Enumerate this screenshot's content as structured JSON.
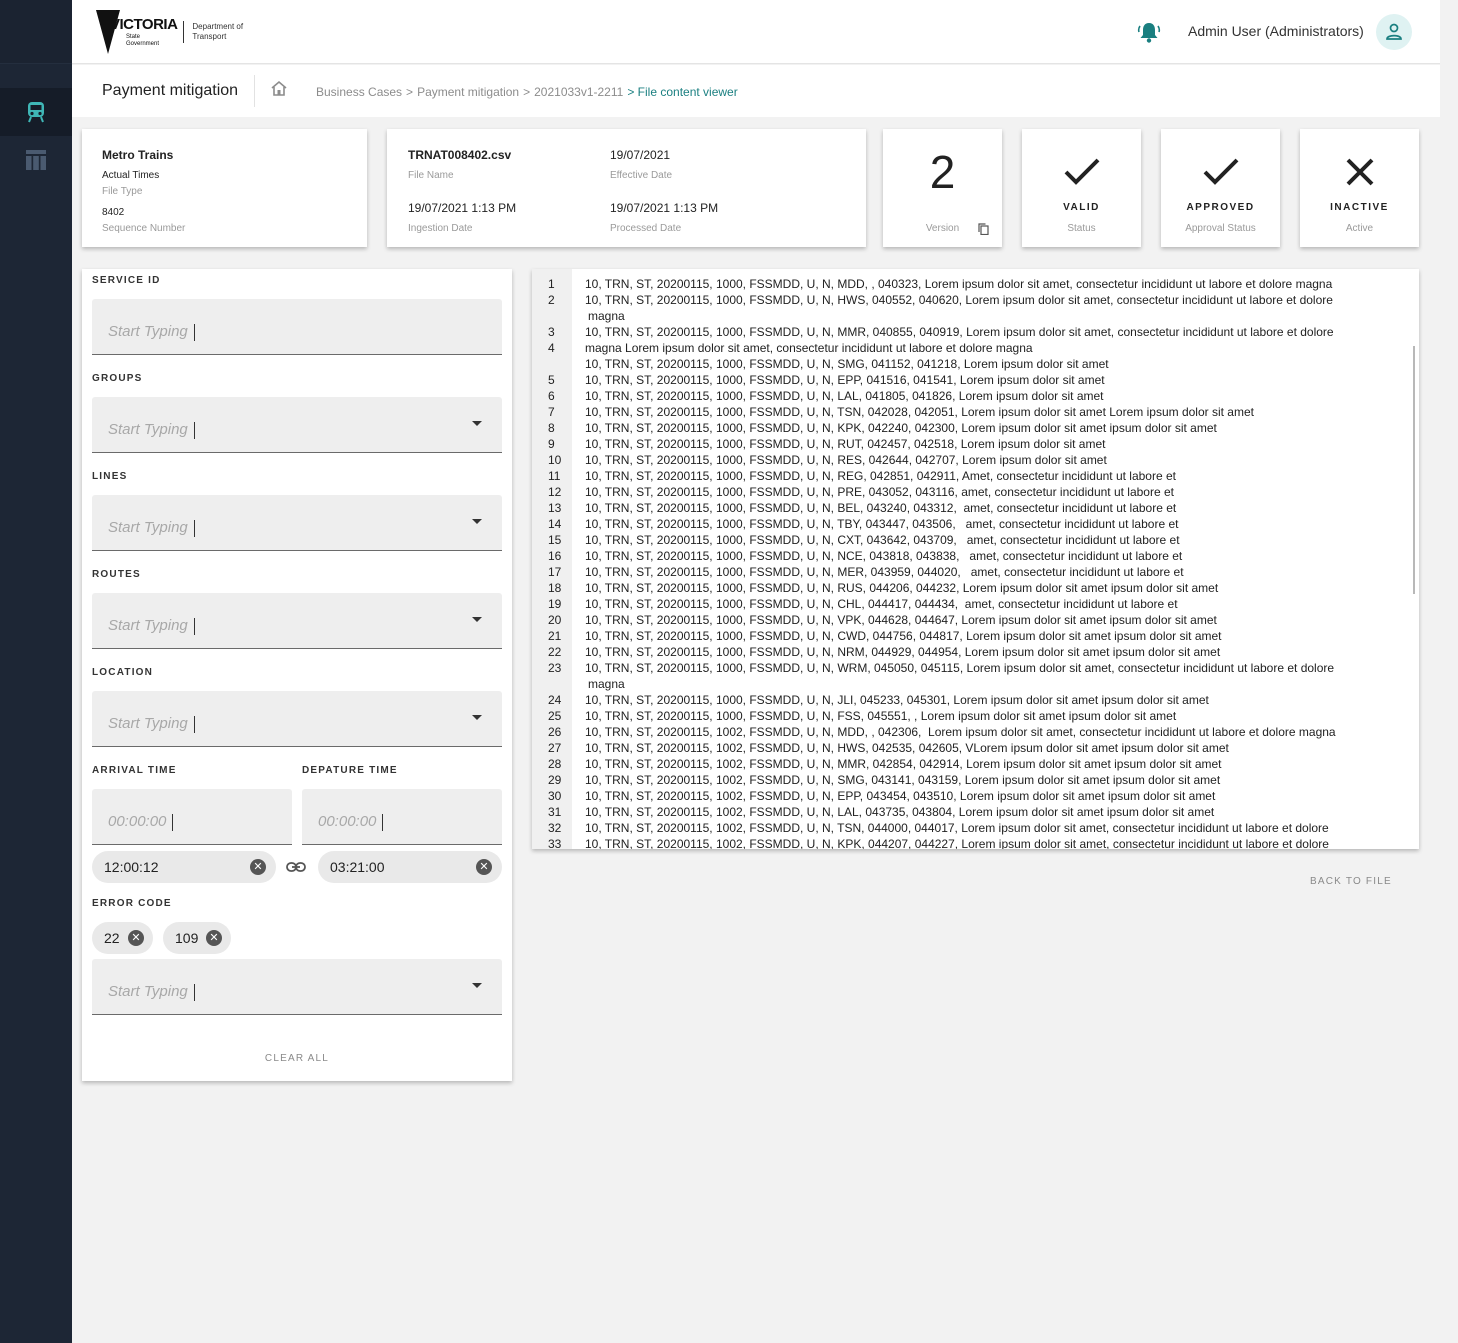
{
  "header": {
    "logo_main": "VICTORIA",
    "logo_sub": "State Government",
    "logo_dept": "Department of Transport",
    "user_name": "Admin User (Administrators)"
  },
  "sidebar": {
    "items": [
      {
        "icon": "train-icon",
        "active": true
      },
      {
        "icon": "table-icon",
        "active": false
      }
    ]
  },
  "breadcrumb": {
    "page_title": "Payment mitigation",
    "items": [
      "Business Cases",
      ">",
      "Payment mitigation",
      ">",
      "2021033v1-2211"
    ],
    "current": "> File content viewer"
  },
  "cards": {
    "operator": {
      "name": "Metro Trains",
      "file_type": "Actual Times",
      "file_type_label": "File Type",
      "sequence": "8402",
      "sequence_label": "Sequence Number"
    },
    "file": {
      "file_name": "TRNAT008402.csv",
      "file_name_label": "File Name",
      "effective_date": "19/07/2021",
      "effective_date_label": "Effective Date",
      "ingestion_date": "19/07/2021 1:13 PM",
      "ingestion_date_label": "Ingestion Date",
      "processed_date": "19/07/2021 1:13 PM",
      "processed_date_label": "Processed Date"
    },
    "version": {
      "value": "2",
      "label": "Version"
    },
    "status": {
      "value": "VALID",
      "label": "Status"
    },
    "approval": {
      "value": "APPROVED",
      "label": "Approval Status"
    },
    "active": {
      "value": "INACTIVE",
      "label": "Active"
    }
  },
  "filters": {
    "service_id": {
      "label": "SERVICE ID",
      "placeholder": "Start Typing"
    },
    "groups": {
      "label": "GROUPS",
      "placeholder": "Start Typing"
    },
    "lines": {
      "label": "LINES",
      "placeholder": "Start Typing"
    },
    "routes": {
      "label": "ROUTES",
      "placeholder": "Start Typing"
    },
    "location": {
      "label": "LOCATION",
      "placeholder": "Start Typing"
    },
    "arrival": {
      "label": "ARRIVAL TIME",
      "placeholder": "00:00:00",
      "chip": "12:00:12"
    },
    "departure": {
      "label": "DEPATURE TIME",
      "placeholder": "00:00:00",
      "chip": "03:21:00"
    },
    "error_code": {
      "label": "ERROR CODE",
      "chips": [
        "22",
        "109"
      ],
      "placeholder": "Start Typing"
    },
    "clear_all": "CLEAR ALL"
  },
  "viewer": {
    "lines": [
      {
        "n": "1",
        "t": "10, TRN, ST, 20200115, 1000, FSSMDD, U, N, MDD, , 040323, Lorem ipsum dolor sit amet, consectetur incididunt ut labore et dolore magna"
      },
      {
        "n": "2",
        "t": "10, TRN, ST, 20200115, 1000, FSSMDD, U, N, HWS, 040552, 040620, Lorem ipsum dolor sit amet, consectetur incididunt ut labore et dolore magna"
      },
      {
        "n": "3",
        "t": "10, TRN, ST, 20200115, 1000, FSSMDD, U, N, MMR, 040855, 040919, Lorem ipsum dolor sit amet, consectetur incididunt ut labore et dolore"
      },
      {
        "n": "4",
        "t": "magna Lorem ipsum dolor sit amet, consectetur incididunt ut labore et dolore magna"
      },
      {
        "n": "",
        "t": "10, TRN, ST, 20200115, 1000, FSSMDD, U, N, SMG, 041152, 041218, Lorem ipsum dolor sit amet"
      },
      {
        "n": "5",
        "t": "10, TRN, ST, 20200115, 1000, FSSMDD, U, N, EPP, 041516, 041541, Lorem ipsum dolor sit amet"
      },
      {
        "n": "6",
        "t": "10, TRN, ST, 20200115, 1000, FSSMDD, U, N, LAL, 041805, 041826, Lorem ipsum dolor sit amet"
      },
      {
        "n": "7",
        "t": "10, TRN, ST, 20200115, 1000, FSSMDD, U, N, TSN, 042028, 042051, Lorem ipsum dolor sit amet Lorem ipsum dolor sit amet"
      },
      {
        "n": "8",
        "t": "10, TRN, ST, 20200115, 1000, FSSMDD, U, N, KPK, 042240, 042300, Lorem ipsum dolor sit amet ipsum dolor sit amet"
      },
      {
        "n": "9",
        "t": "10, TRN, ST, 20200115, 1000, FSSMDD, U, N, RUT, 042457, 042518, Lorem ipsum dolor sit amet"
      },
      {
        "n": "10",
        "t": "10, TRN, ST, 20200115, 1000, FSSMDD, U, N, RES, 042644, 042707, Lorem ipsum dolor sit amet"
      },
      {
        "n": "11",
        "t": "10, TRN, ST, 20200115, 1000, FSSMDD, U, N, REG, 042851, 042911, Amet, consectetur incididunt ut labore et"
      },
      {
        "n": "12",
        "t": "10, TRN, ST, 20200115, 1000, FSSMDD, U, N, PRE, 043052, 043116, amet, consectetur incididunt ut labore et"
      },
      {
        "n": "13",
        "t": "10, TRN, ST, 20200115, 1000, FSSMDD, U, N, BEL, 043240, 043312,  amet, consectetur incididunt ut labore et"
      },
      {
        "n": "14",
        "t": "10, TRN, ST, 20200115, 1000, FSSMDD, U, N, TBY, 043447, 043506,   amet, consectetur incididunt ut labore et"
      },
      {
        "n": "15",
        "t": "10, TRN, ST, 20200115, 1000, FSSMDD, U, N, CXT, 043642, 043709,   amet, consectetur incididunt ut labore et"
      },
      {
        "n": "16",
        "t": "10, TRN, ST, 20200115, 1000, FSSMDD, U, N, NCE, 043818, 043838,   amet, consectetur incididunt ut labore et"
      },
      {
        "n": "17",
        "t": "10, TRN, ST, 20200115, 1000, FSSMDD, U, N, MER, 043959, 044020,   amet, consectetur incididunt ut labore et"
      },
      {
        "n": "18",
        "t": "10, TRN, ST, 20200115, 1000, FSSMDD, U, N, RUS, 044206, 044232, Lorem ipsum dolor sit amet ipsum dolor sit amet"
      },
      {
        "n": "19",
        "t": "10, TRN, ST, 20200115, 1000, FSSMDD, U, N, CHL, 044417, 044434,  amet, consectetur incididunt ut labore et"
      },
      {
        "n": "20",
        "t": "10, TRN, ST, 20200115, 1000, FSSMDD, U, N, VPK, 044628, 044647, Lorem ipsum dolor sit amet ipsum dolor sit amet"
      },
      {
        "n": "21",
        "t": "10, TRN, ST, 20200115, 1000, FSSMDD, U, N, CWD, 044756, 044817, Lorem ipsum dolor sit amet ipsum dolor sit amet"
      },
      {
        "n": "22",
        "t": "10, TRN, ST, 20200115, 1000, FSSMDD, U, N, NRM, 044929, 044954, Lorem ipsum dolor sit amet ipsum dolor sit amet"
      },
      {
        "n": "23",
        "t": "10, TRN, ST, 20200115, 1000, FSSMDD, U, N, WRM, 045050, 045115, Lorem ipsum dolor sit amet, consectetur incididunt ut labore et dolore magna"
      },
      {
        "n": "24",
        "t": "10, TRN, ST, 20200115, 1000, FSSMDD, U, N, JLI, 045233, 045301, Lorem ipsum dolor sit amet ipsum dolor sit amet"
      },
      {
        "n": "25",
        "t": "10, TRN, ST, 20200115, 1000, FSSMDD, U, N, FSS, 045551, , Lorem ipsum dolor sit amet ipsum dolor sit amet"
      },
      {
        "n": "26",
        "t": "10, TRN, ST, 20200115, 1002, FSSMDD, U, N, MDD, , 042306,  Lorem ipsum dolor sit amet, consectetur incididunt ut labore et dolore magna"
      },
      {
        "n": "27",
        "t": "10, TRN, ST, 20200115, 1002, FSSMDD, U, N, HWS, 042535, 042605, VLorem ipsum dolor sit amet ipsum dolor sit amet"
      },
      {
        "n": "28",
        "t": "10, TRN, ST, 20200115, 1002, FSSMDD, U, N, MMR, 042854, 042914, Lorem ipsum dolor sit amet ipsum dolor sit amet"
      },
      {
        "n": "29",
        "t": "10, TRN, ST, 20200115, 1002, FSSMDD, U, N, SMG, 043141, 043159, Lorem ipsum dolor sit amet ipsum dolor sit amet"
      },
      {
        "n": "30",
        "t": "10, TRN, ST, 20200115, 1002, FSSMDD, U, N, EPP, 043454, 043510, Lorem ipsum dolor sit amet ipsum dolor sit amet"
      },
      {
        "n": "31",
        "t": "10, TRN, ST, 20200115, 1002, FSSMDD, U, N, LAL, 043735, 043804, Lorem ipsum dolor sit amet ipsum dolor sit amet"
      },
      {
        "n": "32",
        "t": "10, TRN, ST, 20200115, 1002, FSSMDD, U, N, TSN, 044000, 044017, Lorem ipsum dolor sit amet, consectetur incididunt ut labore et dolore"
      },
      {
        "n": "33",
        "t": "10, TRN, ST, 20200115, 1002, FSSMDD, U, N, KPK, 044207, 044227, Lorem ipsum dolor sit amet, consectetur incididunt ut labore et dolore"
      }
    ],
    "back_to_file": "BACK TO FILE"
  },
  "colors": {
    "accent": "#1a7f80",
    "sidebar": "#1d2635",
    "sidebar_icon": "#4fc3c3"
  }
}
